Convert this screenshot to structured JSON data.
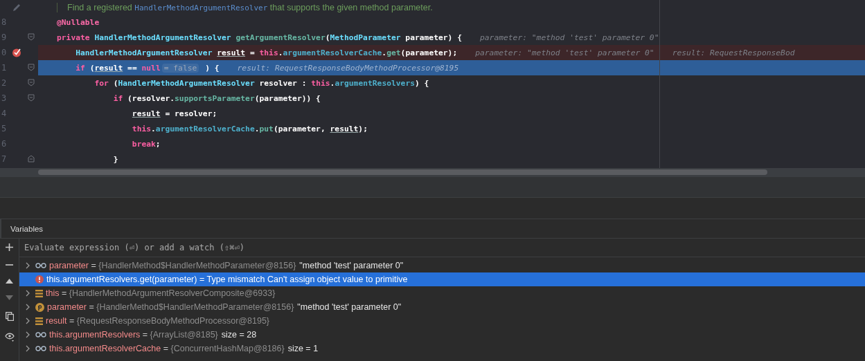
{
  "editor": {
    "doc_comment": [
      {
        "t": "Find a registered ",
        "kind": "doc"
      },
      {
        "t": "HandlerMethodArgumentResolver",
        "kind": "docref"
      },
      {
        "t": " that supports the given method parameter.",
        "kind": "doc"
      }
    ],
    "lines": [
      {
        "number": "8",
        "fold_start": false,
        "fold_end": false,
        "breakpoint": false,
        "current": false,
        "tokens": [
          {
            "t": "@Nullable",
            "kind": "ann"
          }
        ]
      },
      {
        "number": "9",
        "fold_start": true,
        "fold_end": false,
        "breakpoint": false,
        "current": false,
        "tokens": [
          {
            "t": "private ",
            "kind": "kw"
          },
          {
            "t": "HandlerMethodArgumentResolver ",
            "kind": "type"
          },
          {
            "t": "getArgumentResolver",
            "kind": "method"
          },
          {
            "t": "(",
            "kind": "plain"
          },
          {
            "t": "MethodParameter",
            "kind": "type"
          },
          {
            "t": " parameter) {",
            "kind": "plain"
          }
        ],
        "hints": [
          "parameter: \"method 'test' parameter 0\""
        ]
      },
      {
        "number": "0",
        "fold_start": false,
        "fold_end": false,
        "breakpoint": true,
        "current": false,
        "tokens": [
          {
            "t": "    HandlerMethodArgumentResolver ",
            "kind": "type"
          },
          {
            "t": "result",
            "kind": "var"
          },
          {
            "t": " = ",
            "kind": "plain"
          },
          {
            "t": "this",
            "kind": "kw"
          },
          {
            "t": ".",
            "kind": "plain"
          },
          {
            "t": "argumentResolverCache",
            "kind": "field"
          },
          {
            "t": ".",
            "kind": "plain"
          },
          {
            "t": "get",
            "kind": "method"
          },
          {
            "t": "(parameter);",
            "kind": "plain"
          }
        ],
        "hints": [
          "parameter: \"method 'test' parameter 0\"",
          "result: RequestResponseBod"
        ]
      },
      {
        "number": "1",
        "fold_start": true,
        "fold_end": false,
        "breakpoint": false,
        "current": true,
        "tokens": [
          {
            "t": "    if",
            "kind": "kw"
          },
          {
            "t": " (",
            "kind": "plain"
          },
          {
            "t": "result",
            "kind": "var"
          },
          {
            "t": " == ",
            "kind": "plain"
          },
          {
            "t": "null",
            "kind": "kw"
          },
          {
            "t": "= false",
            "kind": "chip"
          },
          {
            "t": " ) {",
            "kind": "plain"
          }
        ],
        "hints": [
          "result: RequestResponseBodyMethodProcessor@8195"
        ]
      },
      {
        "number": "2",
        "fold_start": true,
        "fold_end": false,
        "breakpoint": false,
        "current": false,
        "tokens": [
          {
            "t": "        for",
            "kind": "kw"
          },
          {
            "t": " (",
            "kind": "plain"
          },
          {
            "t": "HandlerMethodArgumentResolver",
            "kind": "type"
          },
          {
            "t": " resolver : ",
            "kind": "plain"
          },
          {
            "t": "this",
            "kind": "kw"
          },
          {
            "t": ".",
            "kind": "plain"
          },
          {
            "t": "argumentResolvers",
            "kind": "field"
          },
          {
            "t": ") {",
            "kind": "plain"
          }
        ]
      },
      {
        "number": "3",
        "fold_start": true,
        "fold_end": false,
        "breakpoint": false,
        "current": false,
        "tokens": [
          {
            "t": "            if",
            "kind": "kw"
          },
          {
            "t": " (resolver.",
            "kind": "plain"
          },
          {
            "t": "supportsParameter",
            "kind": "method"
          },
          {
            "t": "(parameter)) {",
            "kind": "plain"
          }
        ]
      },
      {
        "number": "4",
        "fold_start": false,
        "fold_end": false,
        "breakpoint": false,
        "current": false,
        "tokens": [
          {
            "t": "                result",
            "kind": "var"
          },
          {
            "t": " = resolver;",
            "kind": "plain"
          }
        ]
      },
      {
        "number": "5",
        "fold_start": false,
        "fold_end": false,
        "breakpoint": false,
        "current": false,
        "tokens": [
          {
            "t": "                this",
            "kind": "kw"
          },
          {
            "t": ".",
            "kind": "plain"
          },
          {
            "t": "argumentResolverCache",
            "kind": "field"
          },
          {
            "t": ".",
            "kind": "plain"
          },
          {
            "t": "put",
            "kind": "method"
          },
          {
            "t": "(parameter, ",
            "kind": "plain"
          },
          {
            "t": "result",
            "kind": "var"
          },
          {
            "t": ");",
            "kind": "plain"
          }
        ]
      },
      {
        "number": "6",
        "fold_start": false,
        "fold_end": false,
        "breakpoint": false,
        "current": false,
        "tokens": [
          {
            "t": "                break",
            "kind": "kw"
          },
          {
            "t": ";",
            "kind": "plain"
          }
        ]
      },
      {
        "number": "7",
        "fold_start": false,
        "fold_end": true,
        "breakpoint": false,
        "current": false,
        "tokens": [
          {
            "t": "            }",
            "kind": "plain"
          }
        ]
      }
    ]
  },
  "variables_panel": {
    "title": "Variables",
    "evaluate": {
      "placeholder": "Evaluate expression (⏎) or add a watch (⇧⌘⏎)"
    },
    "rows": [
      {
        "kind": "watch",
        "expanded": false,
        "selected": false,
        "name": "parameter",
        "equals": "=",
        "value": "{HandlerMethod$HandlerMethodParameter@8156}",
        "extra": "\"method 'test' parameter 0\""
      },
      {
        "kind": "error",
        "selected": true,
        "message": "this.argumentResolvers.get(parameter) = Type mismatch Can't assign object value to primitive"
      },
      {
        "kind": "field",
        "expanded": false,
        "selected": false,
        "name": "this",
        "equals": "=",
        "value": "{HandlerMethodArgumentResolverComposite@6933}"
      },
      {
        "kind": "param",
        "expanded": false,
        "selected": false,
        "name": "parameter",
        "equals": "=",
        "value": "{HandlerMethod$HandlerMethodParameter@8156}",
        "extra": "\"method 'test' parameter 0\""
      },
      {
        "kind": "field",
        "expanded": false,
        "selected": false,
        "name": "result",
        "equals": "=",
        "value": "{RequestResponseBodyMethodProcessor@8195}"
      },
      {
        "kind": "watch",
        "expanded": false,
        "selected": false,
        "name": "this.argumentResolvers",
        "equals": "=",
        "value": "{ArrayList@8185}",
        "extra": "size = 28"
      },
      {
        "kind": "watch",
        "expanded": false,
        "selected": false,
        "name": "this.argumentResolverCache",
        "equals": "=",
        "value": "{ConcurrentHashMap@8186}",
        "extra": "size = 1"
      }
    ]
  }
}
